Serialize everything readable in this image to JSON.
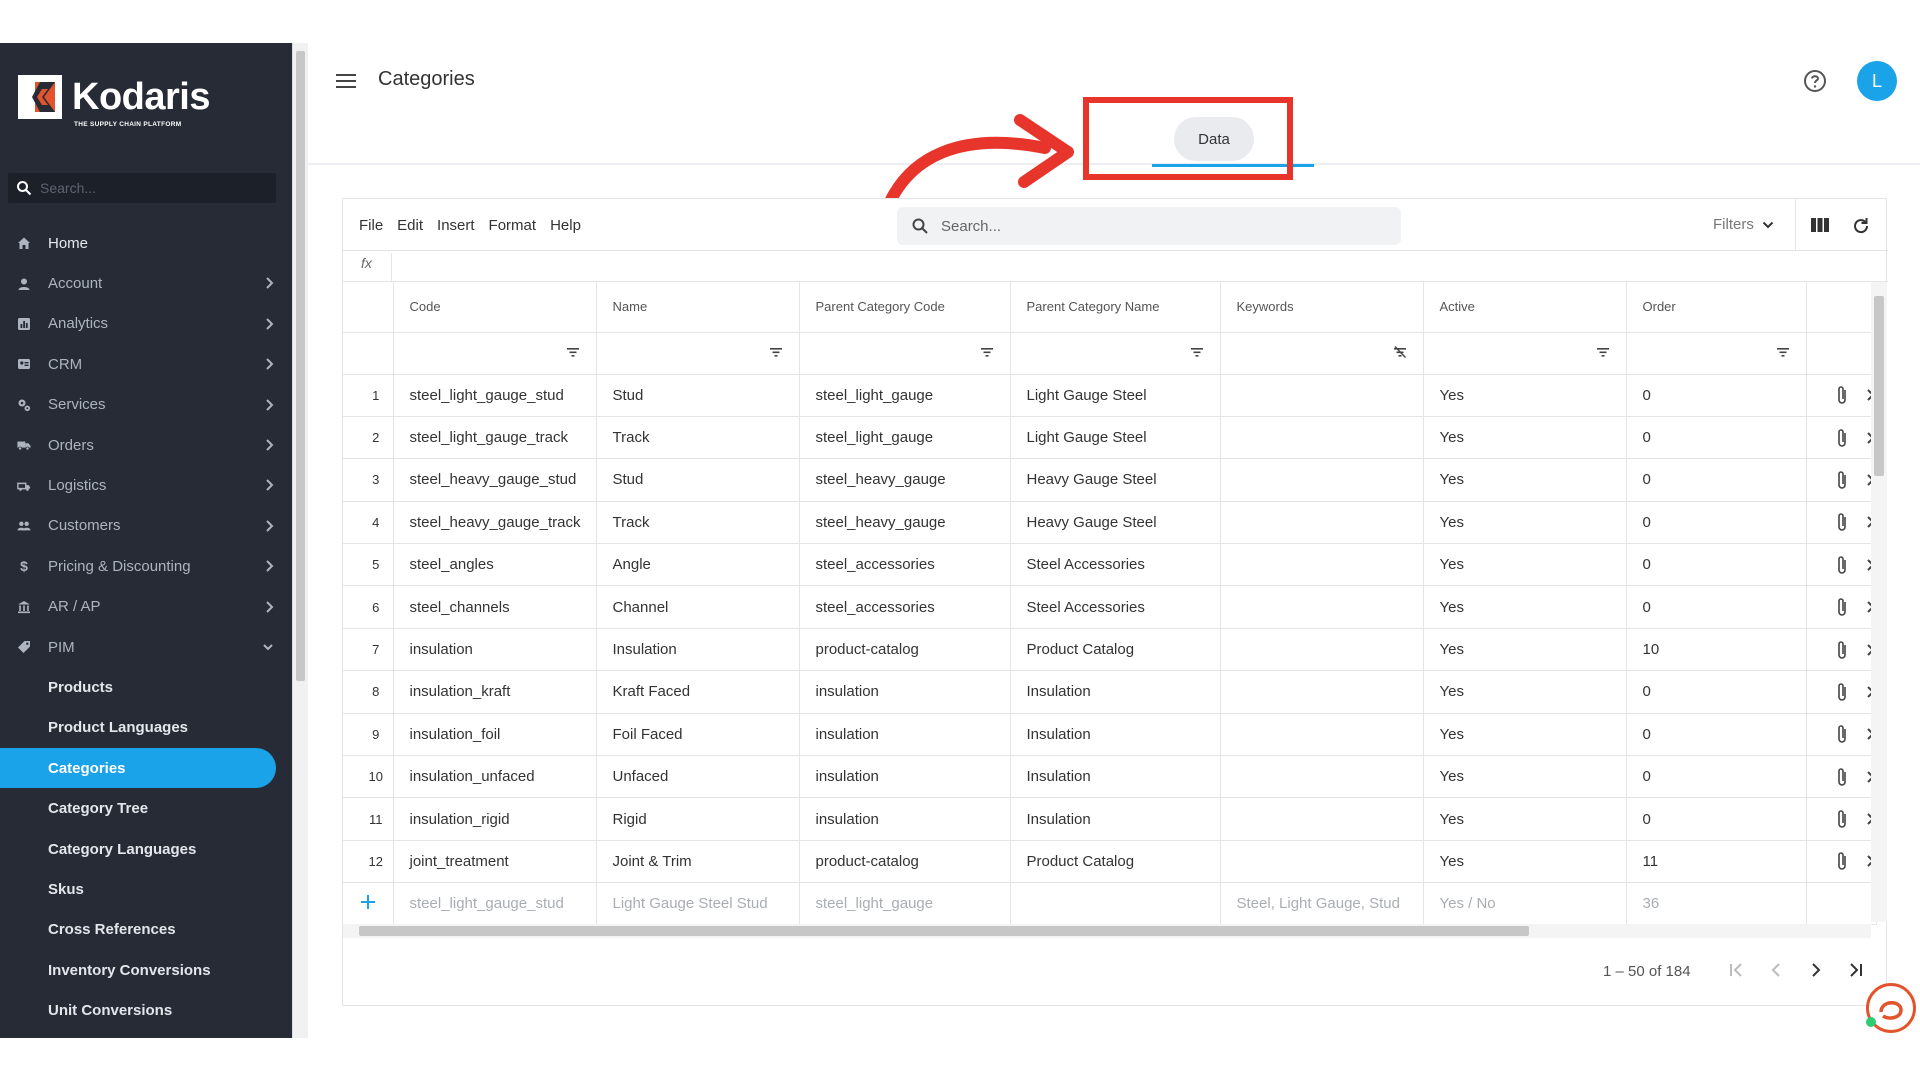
{
  "sidebar": {
    "logo_text": "Kodaris",
    "logo_tagline": "THE SUPPLY CHAIN PLATFORM",
    "search_placeholder": "Search...",
    "items": [
      {
        "label": "Home",
        "icon": "home-icon"
      },
      {
        "label": "Account",
        "icon": "person-icon"
      },
      {
        "label": "Analytics",
        "icon": "chart-icon"
      },
      {
        "label": "CRM",
        "icon": "contact-card-icon"
      },
      {
        "label": "Services",
        "icon": "gears-icon"
      },
      {
        "label": "Orders",
        "icon": "truck-icon"
      },
      {
        "label": "Logistics",
        "icon": "shipping-icon"
      },
      {
        "label": "Customers",
        "icon": "people-icon"
      },
      {
        "label": "Pricing & Discounting",
        "icon": "dollar-icon"
      },
      {
        "label": "AR / AP",
        "icon": "bank-icon"
      },
      {
        "label": "PIM",
        "icon": "tag-icon"
      }
    ],
    "pim_children": [
      "Products",
      "Product Languages",
      "Categories",
      "Category Tree",
      "Category Languages",
      "Skus",
      "Cross References",
      "Inventory Conversions",
      "Unit Conversions"
    ],
    "active_child": "Categories"
  },
  "header": {
    "title": "Categories",
    "tab_label": "Data",
    "avatar_initial": "L"
  },
  "toolbar": {
    "menus": [
      "File",
      "Edit",
      "Insert",
      "Format",
      "Help"
    ],
    "search_placeholder": "Search...",
    "filters_label": "Filters",
    "fx_label": "fx"
  },
  "grid": {
    "columns": [
      "Code",
      "Name",
      "Parent Category Code",
      "Parent Category Name",
      "Keywords",
      "Active",
      "Order"
    ],
    "rows": [
      {
        "n": "1",
        "code": "steel_light_gauge_stud",
        "name": "Stud",
        "pcode": "steel_light_gauge",
        "pname": "Light Gauge Steel",
        "keywords": "",
        "active": "Yes",
        "order": "0"
      },
      {
        "n": "2",
        "code": "steel_light_gauge_track",
        "name": "Track",
        "pcode": "steel_light_gauge",
        "pname": "Light Gauge Steel",
        "keywords": "",
        "active": "Yes",
        "order": "0"
      },
      {
        "n": "3",
        "code": "steel_heavy_gauge_stud",
        "name": "Stud",
        "pcode": "steel_heavy_gauge",
        "pname": "Heavy Gauge Steel",
        "keywords": "",
        "active": "Yes",
        "order": "0"
      },
      {
        "n": "4",
        "code": "steel_heavy_gauge_track",
        "name": "Track",
        "pcode": "steel_heavy_gauge",
        "pname": "Heavy Gauge Steel",
        "keywords": "",
        "active": "Yes",
        "order": "0"
      },
      {
        "n": "5",
        "code": "steel_angles",
        "name": "Angle",
        "pcode": "steel_accessories",
        "pname": "Steel Accessories",
        "keywords": "",
        "active": "Yes",
        "order": "0"
      },
      {
        "n": "6",
        "code": "steel_channels",
        "name": "Channel",
        "pcode": "steel_accessories",
        "pname": "Steel Accessories",
        "keywords": "",
        "active": "Yes",
        "order": "0"
      },
      {
        "n": "7",
        "code": "insulation",
        "name": "Insulation",
        "pcode": "product-catalog",
        "pname": "Product Catalog",
        "keywords": "",
        "active": "Yes",
        "order": "10"
      },
      {
        "n": "8",
        "code": "insulation_kraft",
        "name": "Kraft Faced",
        "pcode": "insulation",
        "pname": "Insulation",
        "keywords": "",
        "active": "Yes",
        "order": "0"
      },
      {
        "n": "9",
        "code": "insulation_foil",
        "name": "Foil Faced",
        "pcode": "insulation",
        "pname": "Insulation",
        "keywords": "",
        "active": "Yes",
        "order": "0"
      },
      {
        "n": "10",
        "code": "insulation_unfaced",
        "name": "Unfaced",
        "pcode": "insulation",
        "pname": "Insulation",
        "keywords": "",
        "active": "Yes",
        "order": "0"
      },
      {
        "n": "11",
        "code": "insulation_rigid",
        "name": "Rigid",
        "pcode": "insulation",
        "pname": "Insulation",
        "keywords": "",
        "active": "Yes",
        "order": "0"
      },
      {
        "n": "12",
        "code": "joint_treatment",
        "name": "Joint & Trim",
        "pcode": "product-catalog",
        "pname": "Product Catalog",
        "keywords": "",
        "active": "Yes",
        "order": "11"
      }
    ],
    "new_row_placeholders": {
      "code": "steel_light_gauge_stud",
      "name": "Light Gauge Steel Stud",
      "pcode": "steel_light_gauge",
      "pname": "",
      "keywords": "Steel, Light Gauge, Stud",
      "active": "Yes / No",
      "order": "36"
    },
    "pager_text": "1 – 50 of 184"
  },
  "colors": {
    "accent": "#1aa3e8",
    "sidebar_bg": "#262b35",
    "highlight": "#e7352c"
  }
}
